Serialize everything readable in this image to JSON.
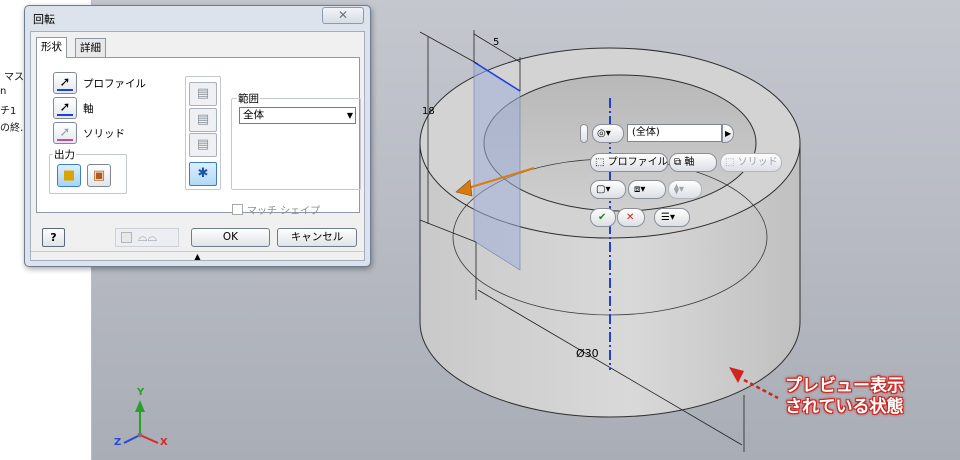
{
  "browser": {
    "items": [
      "マスク",
      "n",
      "チ1",
      "の終…"
    ]
  },
  "dialog": {
    "title": "回転",
    "close_glyph": "✕",
    "tabs": [
      {
        "label": "形状"
      },
      {
        "label": "詳細"
      }
    ],
    "profile_label": "プロファイル",
    "axis_label": "軸",
    "solid_label": "ソリッド",
    "output_label": "出力",
    "range_label": "範囲",
    "range_value": "全体",
    "match_shape_label": "マッチ シェイプ",
    "ok_label": "OK",
    "cancel_label": "キャンセル",
    "help_glyph": "?"
  },
  "model": {
    "dim_width": "5",
    "dim_height": "18",
    "dim_diameter": "Ø30"
  },
  "minitoolbar": {
    "range_value": "(全体)",
    "profile_label": "プロファイル",
    "axis_label": "軸",
    "solid_label": "ソリッド",
    "ok_glyph": "✔",
    "cancel_glyph": "✕"
  },
  "triad": {
    "x": "X",
    "y": "Y",
    "z": "Z"
  },
  "annotation": {
    "line1": "プレビュー表示",
    "line2": "されている状態"
  },
  "colors": {
    "accent": "#1a55a5",
    "axis_line": "#1f3fd6",
    "annotation": "#d0241c",
    "preview_arrow": "#e07a10"
  }
}
